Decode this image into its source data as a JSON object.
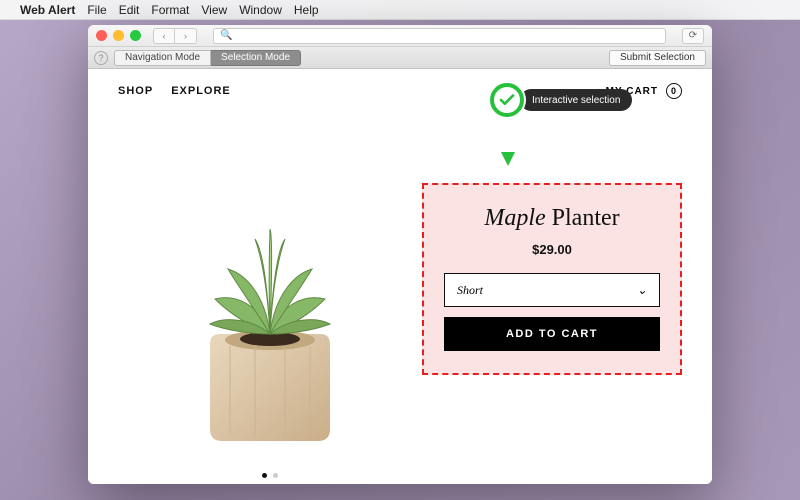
{
  "menubar": {
    "app": "Web Alert",
    "items": [
      "File",
      "Edit",
      "Format",
      "View",
      "Window",
      "Help"
    ]
  },
  "toolbar": {
    "nav_mode": "Navigation Mode",
    "sel_mode": "Selection Mode",
    "submit": "Submit Selection"
  },
  "site": {
    "nav": {
      "shop": "SHOP",
      "explore": "EXPLORE"
    },
    "cart": {
      "label": "MY CART",
      "count": "0"
    }
  },
  "product": {
    "title_ital": "Maple",
    "title_rest": " Planter",
    "price": "$29.00",
    "variant": "Short",
    "add": "ADD TO CART"
  },
  "selection": {
    "label": "Interactive selection"
  }
}
